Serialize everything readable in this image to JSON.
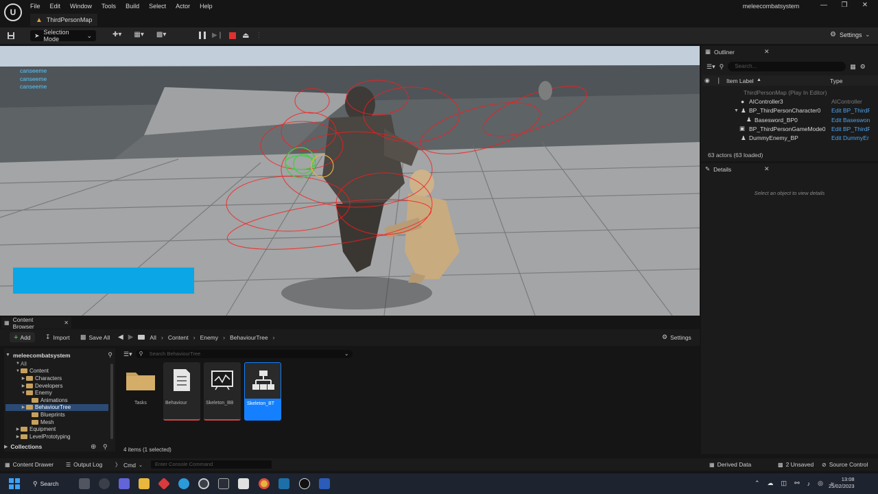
{
  "menu": [
    "File",
    "Edit",
    "Window",
    "Tools",
    "Build",
    "Select",
    "Actor",
    "Help"
  ],
  "project_name": "meleecombatsystem",
  "map_tab": "ThirdPersonMap",
  "toolbar": {
    "selection_mode": "Selection Mode",
    "settings": "Settings"
  },
  "viewport": {
    "debug_text": [
      "canseeme",
      "canseeme",
      "canseeme"
    ],
    "healthbar_color": "#0aa6e6"
  },
  "outliner": {
    "title": "Outliner",
    "search_placeholder": "Search...",
    "col_label": "Item Label",
    "col_type": "Type",
    "rows": [
      {
        "label": "ThirdPersonMap (Play In Editor)",
        "type": "",
        "indent": 0
      },
      {
        "label": "AIController3",
        "type": "AIController",
        "indent": 1
      },
      {
        "label": "BP_ThirdPersonCharacter0",
        "type": "Edit BP_ThirdP",
        "indent": 1
      },
      {
        "label": "Basesword_BP0",
        "type": "Edit Basesword",
        "indent": 2
      },
      {
        "label": "BP_ThirdPersonGameMode0",
        "type": "Edit BP_ThirdP",
        "indent": 0
      },
      {
        "label": "DummyEnemy_BP",
        "type": "Edit DummyEr",
        "indent": 1
      }
    ],
    "actor_count": "63 actors (63 loaded)"
  },
  "details": {
    "title": "Details",
    "empty_text": "Select an object to view details"
  },
  "content_browser": {
    "tab": "Content Browser",
    "add": "Add",
    "import": "Import",
    "save_all": "Save All",
    "breadcrumbs": [
      "All",
      "Content",
      "Enemy",
      "BehaviourTree"
    ],
    "settings": "Settings",
    "root": "meleecombatsystem",
    "tree": [
      {
        "label": "All",
        "level": 0
      },
      {
        "label": "Content",
        "level": 1
      },
      {
        "label": "Characters",
        "level": 2
      },
      {
        "label": "Developers",
        "level": 2
      },
      {
        "label": "Enemy",
        "level": 2
      },
      {
        "label": "Animations",
        "level": 3
      },
      {
        "label": "BehaviourTree",
        "level": 3,
        "selected": true
      },
      {
        "label": "Blueprints",
        "level": 3
      },
      {
        "label": "Mesh",
        "level": 3
      },
      {
        "label": "Equipment",
        "level": 2
      },
      {
        "label": "LevelPrototyping",
        "level": 2
      }
    ],
    "collections": "Collections",
    "search_placeholder": "Search BehaviourTree",
    "assets": [
      {
        "name": "Tasks",
        "kind": "folder"
      },
      {
        "name": "Behaviour",
        "kind": "doc"
      },
      {
        "name": "Skeleton_BB",
        "kind": "blackboard"
      },
      {
        "name": "Skeleton_BT",
        "kind": "tree",
        "selected": true
      }
    ],
    "item_count": "4 items (1 selected)"
  },
  "statusbar": {
    "content_drawer": "Content Drawer",
    "output_log": "Output Log",
    "cmd": "Cmd",
    "console_placeholder": "Enter Console Command",
    "derived_data": "Derived Data",
    "unsaved": "2 Unsaved",
    "source_control": "Source Control"
  },
  "taskbar": {
    "search": "Search",
    "time": "13:08",
    "date": "25/02/2023"
  }
}
